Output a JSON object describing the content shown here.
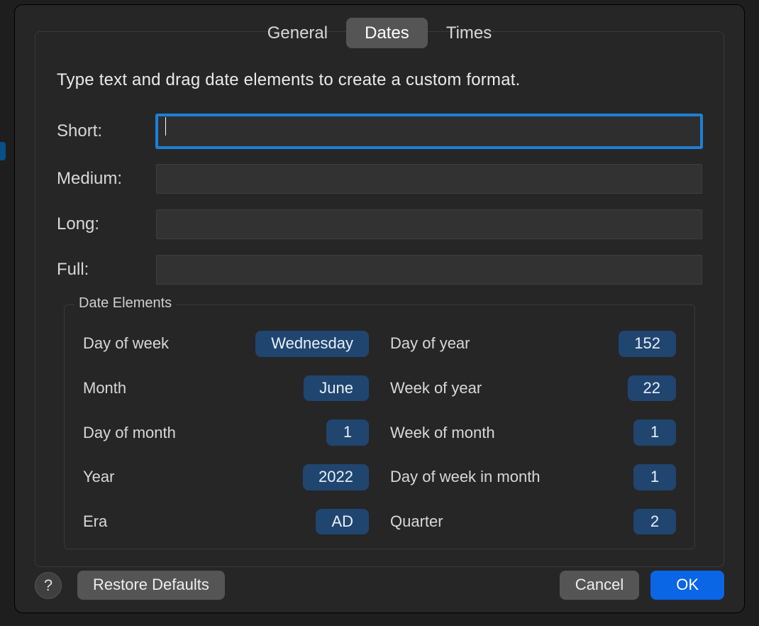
{
  "tabs": {
    "general": "General",
    "dates": "Dates",
    "times": "Times",
    "active": "dates"
  },
  "instruction": "Type text and drag date elements to create a custom format.",
  "formats": {
    "short_label": "Short:",
    "medium_label": "Medium:",
    "long_label": "Long:",
    "full_label": "Full:",
    "short": "",
    "medium": "",
    "long": "",
    "full": ""
  },
  "elements_title": "Date Elements",
  "elements": {
    "day_of_week": {
      "label": "Day of week",
      "value": "Wednesday"
    },
    "day_of_year": {
      "label": "Day of year",
      "value": "152"
    },
    "month": {
      "label": "Month",
      "value": "June"
    },
    "week_of_year": {
      "label": "Week of year",
      "value": "22"
    },
    "day_of_month": {
      "label": "Day of month",
      "value": "1"
    },
    "week_of_month": {
      "label": "Week of month",
      "value": "1"
    },
    "year": {
      "label": "Year",
      "value": "2022"
    },
    "day_of_week_in_month": {
      "label": "Day of week in month",
      "value": "1"
    },
    "era": {
      "label": "Era",
      "value": "AD"
    },
    "quarter": {
      "label": "Quarter",
      "value": "2"
    }
  },
  "buttons": {
    "help": "?",
    "restore": "Restore Defaults",
    "cancel": "Cancel",
    "ok": "OK"
  }
}
